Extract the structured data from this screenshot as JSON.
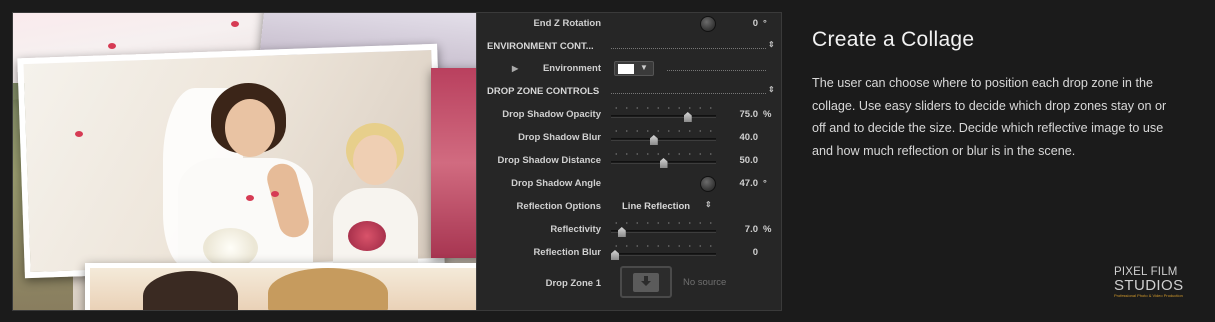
{
  "inspector": {
    "end_z_rotation": {
      "label": "End Z Rotation",
      "value": "0",
      "unit": "°"
    },
    "env_section": {
      "label": "ENVIRONMENT CONT..."
    },
    "environment": {
      "label": "Environment",
      "color": "#ffffff"
    },
    "dz_section": {
      "label": "DROP ZONE CONTROLS"
    },
    "shadow_opacity": {
      "label": "Drop Shadow Opacity",
      "value": "75.0",
      "unit": "%",
      "fraction": 0.75
    },
    "shadow_blur": {
      "label": "Drop Shadow Blur",
      "value": "40.0",
      "fraction": 0.4
    },
    "shadow_distance": {
      "label": "Drop Shadow Distance",
      "value": "50.0",
      "fraction": 0.5
    },
    "shadow_angle": {
      "label": "Drop Shadow Angle",
      "value": "47.0",
      "unit": "°"
    },
    "reflection_options": {
      "label": "Reflection Options",
      "value": "Line Reflection"
    },
    "reflectivity": {
      "label": "Reflectivity",
      "value": "7.0",
      "unit": "%",
      "fraction": 0.07
    },
    "reflection_blur": {
      "label": "Reflection Blur",
      "value": "0",
      "fraction": 0.0
    },
    "drop_zone_1": {
      "label": "Drop Zone 1",
      "status": "No source"
    }
  },
  "content": {
    "heading": "Create a Collage",
    "description": "The user can choose where to position each drop zone in the collage. Use easy sliders to decide which drop zones stay on or off and to decide the size. Decide which reflective image to use and how much reflection or blur is in the scene."
  },
  "brand": {
    "line1": "PIXEL FILM",
    "line2": "STUDIOS",
    "tagline": "Professional Photo & Video Production"
  }
}
